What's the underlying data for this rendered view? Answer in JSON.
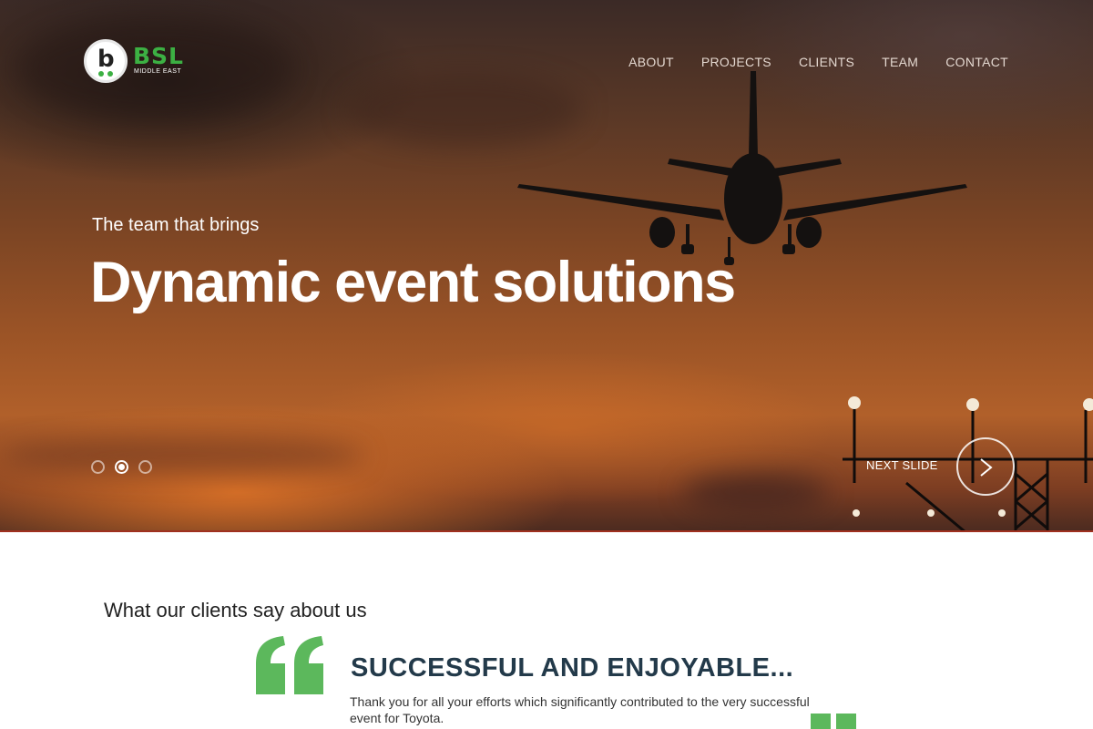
{
  "brand": {
    "name": "BSL",
    "subtitle": "MIDDLE EAST"
  },
  "nav": {
    "items": [
      "ABOUT",
      "PROJECTS",
      "CLIENTS",
      "TEAM",
      "CONTACT"
    ]
  },
  "hero": {
    "tagline": "The team that brings",
    "headline": "Dynamic event solutions",
    "next_label": "NEXT SLIDE",
    "active_slide": 2,
    "slide_count": 3
  },
  "testimonials": {
    "section_title": "What our clients say about us",
    "heading": "SUCCESSFUL AND ENJOYABLE...",
    "body": "Thank you for all your efforts which significantly contributed to the very successful event for Toyota."
  },
  "colors": {
    "accent_green": "#5cb85c",
    "heading_navy": "#233a4a",
    "hero_orange": "#9a5326"
  }
}
